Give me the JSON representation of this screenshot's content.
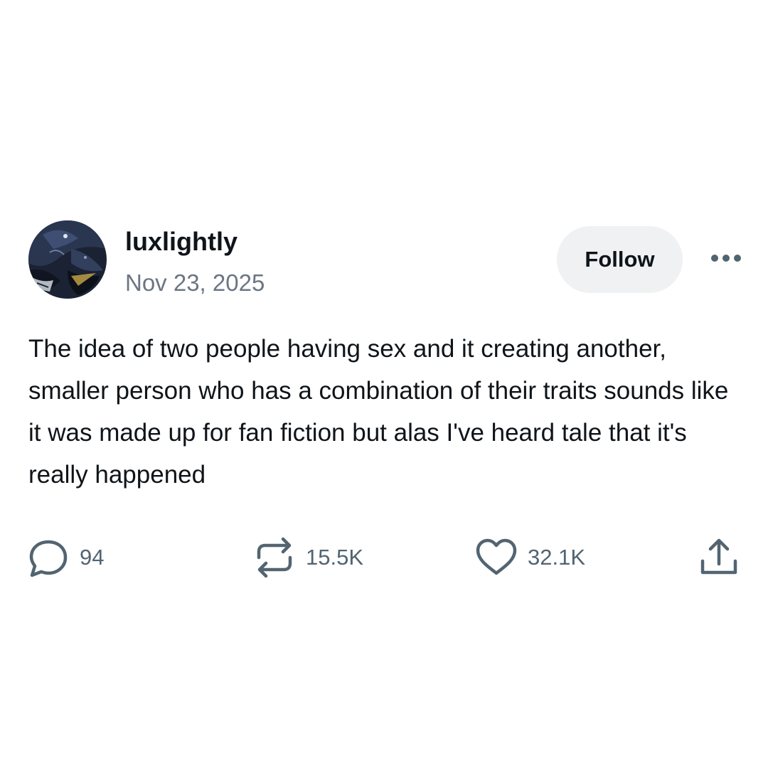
{
  "post": {
    "username": "luxlightly",
    "date": "Nov 23, 2025",
    "follow_label": "Follow",
    "text": "The idea of two people having sex and it creating another, smaller person who has a combination of their traits sounds like it was made up for fan fiction but alas I've heard tale that it's really happened"
  },
  "actions": {
    "replies": "94",
    "reblogs": "15.5K",
    "likes": "32.1K"
  },
  "icons": {
    "reply": "speech-bubble-icon",
    "reblog": "repost-arrows-icon",
    "like": "heart-icon",
    "share": "share-upload-icon",
    "more": "ellipsis-icon"
  },
  "colors": {
    "text": "#0f1419",
    "muted": "#536471",
    "follow_bg": "#eff1f3"
  }
}
